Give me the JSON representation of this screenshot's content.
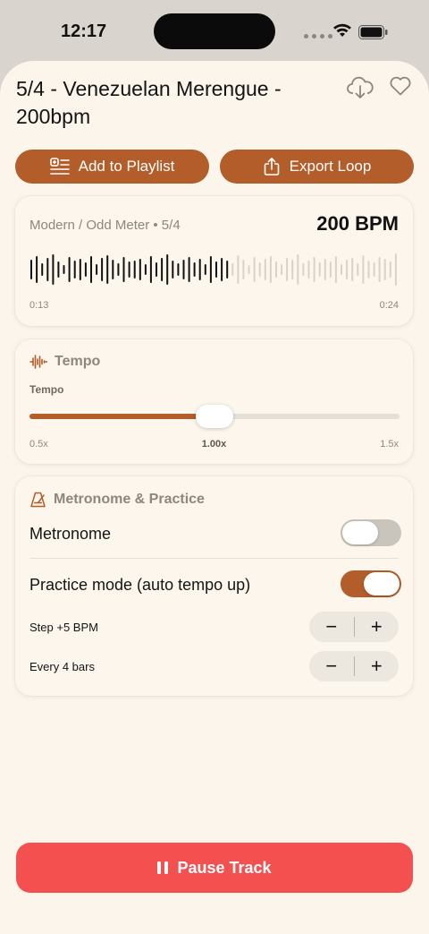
{
  "status_bar": {
    "time": "12:17"
  },
  "header": {
    "title": "5/4 - Venezuelan Merengue - 200bpm"
  },
  "actions": {
    "add_to_playlist": "Add to Playlist",
    "export_loop": "Export Loop"
  },
  "waveform_card": {
    "meta": "Modern / Odd Meter • 5/4",
    "bpm": "200 BPM",
    "elapsed": "0:13",
    "duration": "0:24",
    "progress": 0.54
  },
  "tempo_card": {
    "title": "Tempo",
    "label": "Tempo",
    "min": "0.5x",
    "current": "1.00x",
    "max": "1.5x",
    "value": 0.5
  },
  "metronome_card": {
    "title": "Metronome & Practice",
    "metronome_label": "Metronome",
    "metronome_on": false,
    "practice_label": "Practice mode (auto tempo up)",
    "practice_on": true,
    "step_label": "Step +5 BPM",
    "every_label": "Every 4 bars",
    "minus": "−",
    "plus": "+"
  },
  "player": {
    "pause_label": "Pause Track"
  },
  "colors": {
    "accent": "#b25d2a",
    "background": "#fbf5eb",
    "pause": "#f45050"
  }
}
